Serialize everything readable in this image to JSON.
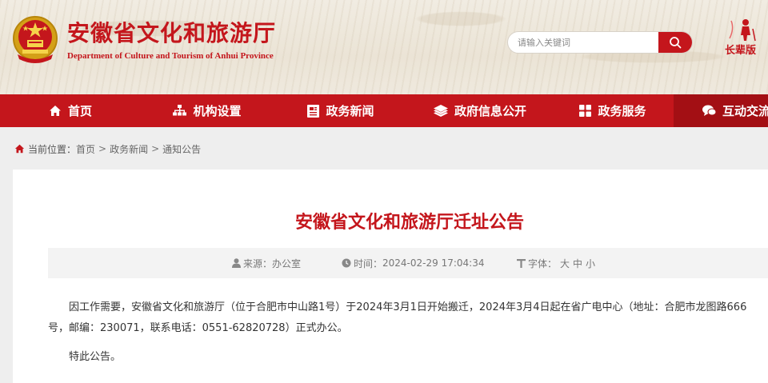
{
  "header": {
    "title_cn": "安徽省文化和旅游厅",
    "title_en": "Department of Culture and Tourism of Anhui Province",
    "search_placeholder": "请输入关键词",
    "elder_mode_label": "长辈版"
  },
  "nav": {
    "items": [
      {
        "label": "首页",
        "icon": "home-icon"
      },
      {
        "label": "机构设置",
        "icon": "org-chart-icon"
      },
      {
        "label": "政务新闻",
        "icon": "news-icon"
      },
      {
        "label": "政府信息公开",
        "icon": "layers-icon"
      },
      {
        "label": "政务服务",
        "icon": "grid-icon"
      },
      {
        "label": "互动交流",
        "icon": "chat-icon"
      }
    ]
  },
  "breadcrumb": {
    "prefix": "当前位置：",
    "items": [
      "首页",
      "政务新闻",
      "通知公告"
    ],
    "separator": ">"
  },
  "article": {
    "title": "安徽省文化和旅游厅迁址公告",
    "source_label": "来源：",
    "source": "办公室",
    "time_label": "时间：",
    "time": "2024-02-29 17:04:34",
    "font_label": "字体：",
    "font_sizes": [
      "大",
      "中",
      "小"
    ],
    "paragraphs": [
      "因工作需要，安徽省文化和旅游厅（位于合肥市中山路1号）于2024年3月1日开始搬迁，2024年3月4日起在省广电中心（地址：合肥市龙图路666号，邮编：230071，联系电话：0551-62820728）正式办公。",
      "特此公告。"
    ]
  },
  "colors": {
    "brand_red": "#c4161c",
    "nav_dark_red": "#a30f14"
  }
}
